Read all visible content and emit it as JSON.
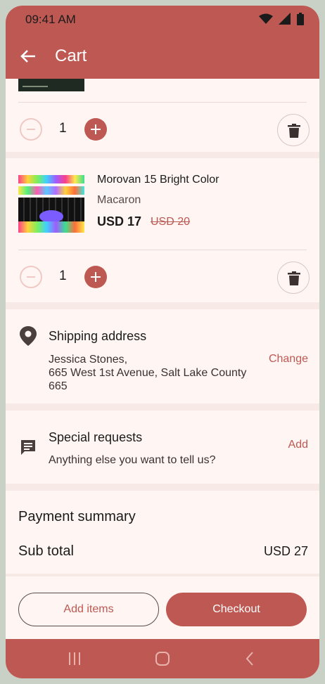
{
  "status_bar": {
    "time": "09:41 AM"
  },
  "app_bar": {
    "title": "Cart"
  },
  "cart_items": [
    {
      "quantity": "1"
    },
    {
      "name": "Morovan 15 Bright Color",
      "variant": "Macaron",
      "price": "USD 17",
      "original_price": "USD 20",
      "quantity": "1"
    }
  ],
  "shipping": {
    "title": "Shipping address",
    "name_line": "Jessica Stones,",
    "address_line1": "665 West 1st Avenue, Salt Lake County",
    "address_line2": "665",
    "action": "Change"
  },
  "special_requests": {
    "title": "Special requests",
    "placeholder": "Anything else you want to tell us?",
    "action": "Add"
  },
  "payment": {
    "title": "Payment summary",
    "subtotal_label": "Sub total",
    "subtotal_value": "USD 27"
  },
  "footer": {
    "add_items_label": "Add items",
    "checkout_label": "Checkout"
  },
  "colors": {
    "primary": "#bd5853",
    "surface": "#fff6f3",
    "background": "#f6e9e6"
  },
  "icons": [
    "wifi-icon",
    "cellular-icon",
    "battery-icon",
    "back-arrow-icon",
    "minus-icon",
    "plus-icon",
    "trash-icon",
    "location-pin-icon",
    "message-icon",
    "recents-icon",
    "home-icon",
    "back-nav-icon"
  ]
}
